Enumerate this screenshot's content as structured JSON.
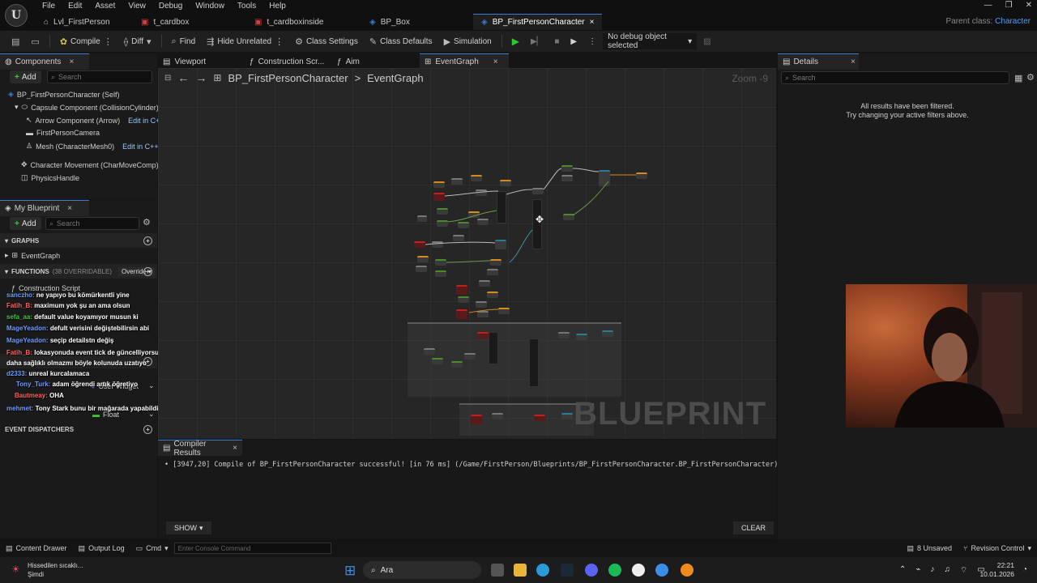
{
  "menu": {
    "logo": "U",
    "items": [
      "File",
      "Edit",
      "Asset",
      "View",
      "Debug",
      "Window",
      "Tools",
      "Help"
    ]
  },
  "doc_tabs": [
    {
      "label": "Lvl_FirstPerson",
      "icon": "level-icon",
      "glyph": "⌂",
      "color": "#bbbbbb"
    },
    {
      "label": "t_cardbox",
      "icon": "texture-icon",
      "glyph": "▣",
      "color": "#d04040"
    },
    {
      "label": "t_cardboxinside",
      "icon": "texture-icon",
      "glyph": "▣",
      "color": "#d04040"
    },
    {
      "label": "BP_Box",
      "icon": "blueprint-icon",
      "glyph": "◈",
      "color": "#3a7bd5"
    },
    {
      "label": "BP_FirstPersonCharacter",
      "icon": "blueprint-icon",
      "glyph": "◈",
      "color": "#3a7bd5",
      "active": true,
      "close": "×"
    }
  ],
  "window_controls": [
    "—",
    "❐",
    "✕"
  ],
  "parent_class": {
    "label": "Parent class:",
    "value": "Character"
  },
  "toolbar": {
    "compile": "Compile",
    "diff": "Diff",
    "find": "Find",
    "hide_unrelated": "Hide Unrelated",
    "class_settings": "Class Settings",
    "class_defaults": "Class Defaults",
    "simulation": "Simulation",
    "debug_select": "No debug object selected"
  },
  "components_panel": {
    "tab": "Components",
    "add": "Add",
    "search_placeholder": "Search",
    "items": [
      {
        "label": "BP_FirstPersonCharacter (Self)"
      },
      {
        "label": "Capsule Component (CollisionCylinder)"
      },
      {
        "label": "Arrow Component (Arrow)",
        "edit": "Edit in C++"
      },
      {
        "label": "FirstPersonCamera"
      },
      {
        "label": "Mesh (CharacterMesh0)",
        "edit": "Edit in C++"
      },
      {
        "label": "Character Movement (CharMoveComp)"
      },
      {
        "label": "PhysicsHandle"
      }
    ]
  },
  "my_blueprint": {
    "tab": "My Blueprint",
    "add": "Add",
    "search_placeholder": "Search",
    "graphs_header": "GRAPHS",
    "event_graph": "EventGraph",
    "functions_header": "FUNCTIONS",
    "functions_count": "(38 OVERRIDABLE)",
    "override": "Override",
    "construction_script": "Construction Script",
    "var_user_widget": "User Widget",
    "var_float": "Float",
    "event_dispatchers": "EVENT DISPATCHERS"
  },
  "chat_overlay": [
    {
      "user": "sanczho:",
      "msg": "ne yapıyo bu kömürkentli yine"
    },
    {
      "user": "Fatih_B:",
      "msg": "maximum yok şu an ama olsun"
    },
    {
      "user": "sefa_aa:",
      "msg": "default value koyamıyor musun ki"
    },
    {
      "user": "MageYeadon:",
      "msg": "defult verisini değiştebilirsin abi"
    },
    {
      "user": "MageYeadon:",
      "msg": "seçip detailstn değiş"
    },
    {
      "user": "Fatih_B:",
      "msg": "lokasyonuda event tick de güncelliyorsun orda olsa"
    },
    {
      "user": "",
      "msg": "daha sağlıklı olmazmı böyle kolunuda uzatıyo"
    },
    {
      "user": "d2333:",
      "msg": "unreal kurcalamaca"
    },
    {
      "user": "Tony_Turk:",
      "msg": "adam öğrendi artık öğretiyo"
    },
    {
      "user": "Bautmeay:",
      "msg": "OHA"
    },
    {
      "user": "mehmet:",
      "msg": "Tony Stark bunu bir mağarada yapabildi"
    }
  ],
  "graph_tabs": [
    {
      "label": "Viewport",
      "icon": "viewport-icon"
    },
    {
      "label": "Construction Scr...",
      "icon": "function-icon"
    },
    {
      "label": "Aim",
      "icon": "function-icon"
    },
    {
      "label": "EventGraph",
      "icon": "graph-icon",
      "active": true
    }
  ],
  "graph": {
    "breadcrumb_root": "BP_FirstPersonCharacter",
    "breadcrumb_sep": ">",
    "breadcrumb_leaf": "EventGraph",
    "zoom": "Zoom -9",
    "watermark": "BLUEPRINT"
  },
  "compiler": {
    "tab": "Compiler Results",
    "message": "[3947,20] Compile of BP_FirstPersonCharacter successful! [in 76 ms] (/Game/FirstPerson/Blueprints/BP_FirstPersonCharacter.BP_FirstPersonCharacter)",
    "show": "SHOW",
    "clear": "CLEAR"
  },
  "details": {
    "tab": "Details",
    "search_placeholder": "Search",
    "filtered_line1": "All results have been filtered.",
    "filtered_line2": "Try changing your active filters above."
  },
  "statusbar": {
    "content_drawer": "Content Drawer",
    "output_log": "Output Log",
    "cmd": "Cmd",
    "console_placeholder": "Enter Console Command",
    "unsaved": "8 Unsaved",
    "revision_control": "Revision Control"
  },
  "taskbar": {
    "weather_line1": "Hissedilen sıcaklı...",
    "weather_line2": "Şimdi",
    "search": "Ara",
    "time": "22:21",
    "date": "10.01.2026"
  }
}
